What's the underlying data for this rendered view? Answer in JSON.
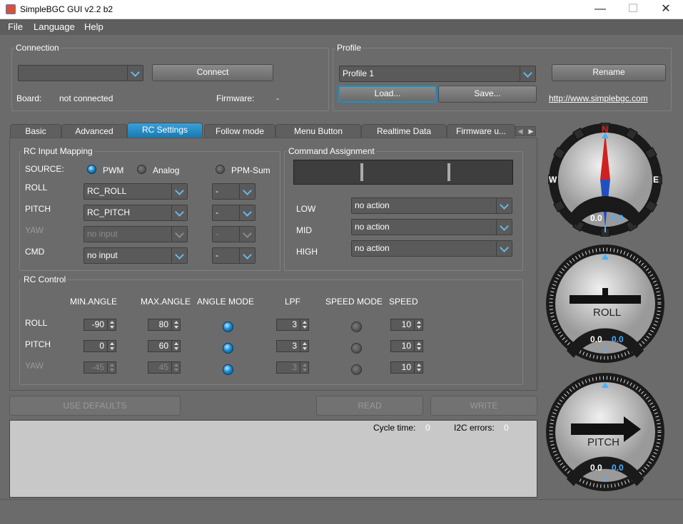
{
  "window": {
    "title": "SimpleBGC GUI v2.2 b2",
    "minimize": "—",
    "maximize": "☐",
    "close": "✕"
  },
  "menu": [
    "File",
    "Language",
    "Help"
  ],
  "connection": {
    "title": "Connection",
    "port_value": "",
    "connect_label": "Connect",
    "board_label": "Board:",
    "board_value": "not connected",
    "firmware_label": "Firmware:",
    "firmware_value": "-"
  },
  "profile": {
    "title": "Profile",
    "selected": "Profile 1",
    "load_label": "Load...",
    "save_label": "Save...",
    "rename_label": "Rename",
    "link": "http://www.simplebgc.com"
  },
  "tabs": [
    "Basic",
    "Advanced",
    "RC Settings",
    "Follow mode",
    "Menu Button",
    "Realtime Data",
    "Firmware u..."
  ],
  "active_tab": "RC Settings",
  "rc_input": {
    "title": "RC Input Mapping",
    "source_label": "SOURCE:",
    "sources": [
      "PWM",
      "Analog",
      "PPM-Sum"
    ],
    "selected_source": "PWM",
    "rows": [
      {
        "label": "ROLL",
        "input": "RC_ROLL",
        "extra": "-",
        "enabled": true
      },
      {
        "label": "PITCH",
        "input": "RC_PITCH",
        "extra": "-",
        "enabled": true
      },
      {
        "label": "YAW",
        "input": "no input",
        "extra": "-",
        "enabled": false
      },
      {
        "label": "CMD",
        "input": "no input",
        "extra": "-",
        "enabled": true
      }
    ]
  },
  "command": {
    "title": "Command Assignment",
    "rows": [
      {
        "label": "LOW",
        "value": "no action"
      },
      {
        "label": "MID",
        "value": "no action"
      },
      {
        "label": "HIGH",
        "value": "no action"
      }
    ]
  },
  "rc_control": {
    "title": "RC Control",
    "headers": [
      "MIN.ANGLE",
      "MAX.ANGLE",
      "ANGLE MODE",
      "LPF",
      "SPEED MODE",
      "SPEED"
    ],
    "rows": [
      {
        "label": "ROLL",
        "min": "-90",
        "max": "80",
        "angle_mode": true,
        "lpf": "3",
        "speed_mode": false,
        "speed": "10",
        "enabled": true
      },
      {
        "label": "PITCH",
        "min": "0",
        "max": "60",
        "angle_mode": true,
        "lpf": "3",
        "speed_mode": false,
        "speed": "10",
        "enabled": true
      },
      {
        "label": "YAW",
        "min": "-45",
        "max": "45",
        "angle_mode": true,
        "lpf": "3",
        "speed_mode": false,
        "speed": "10",
        "enabled": false
      }
    ]
  },
  "actions": {
    "defaults": "USE DEFAULTS",
    "read": "READ",
    "write": "WRITE"
  },
  "status": {
    "cycle_label": "Cycle time:",
    "cycle_value": "0",
    "i2c_label": "I2C errors:",
    "i2c_value": "0"
  },
  "gauges": {
    "yaw": {
      "n": "N",
      "w": "W",
      "e": "E",
      "value1": "0.0",
      "value2": "0.0"
    },
    "roll": {
      "label": "ROLL",
      "value1": "0.0",
      "value2": "0.0"
    },
    "pitch": {
      "label": "PITCH",
      "value1": "0.0",
      "value2": "0.0"
    }
  },
  "colors": {
    "accent": "#1a90c8",
    "value_blue": "#4ab0ff",
    "compass_red": "#d02020",
    "compass_blue": "#2050c0"
  }
}
